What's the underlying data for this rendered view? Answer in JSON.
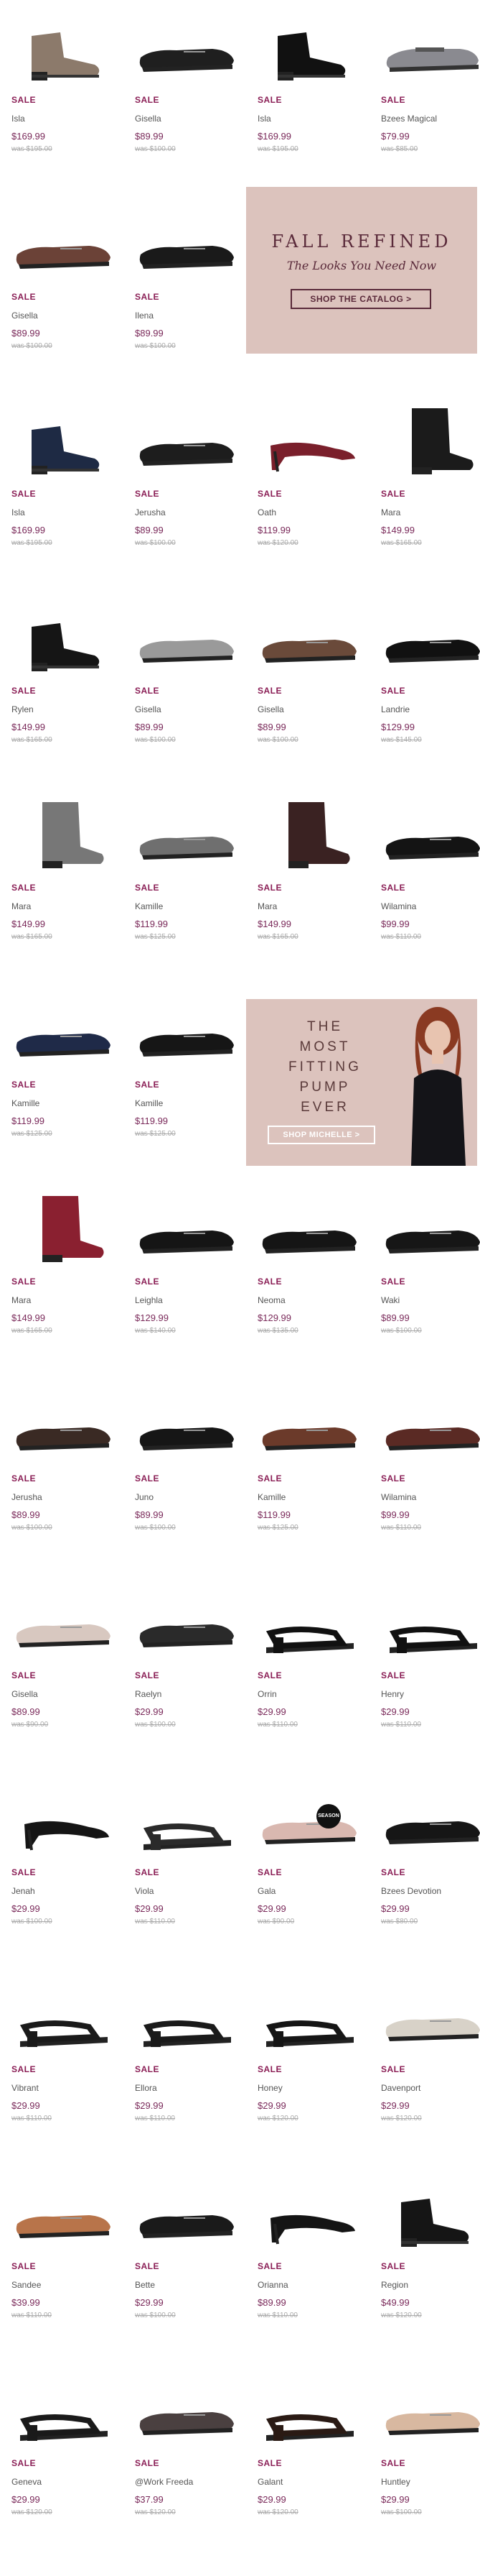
{
  "products": [
    {
      "sale": "SALE",
      "name": "Isla",
      "price": "$169.99",
      "was": "was $195.00",
      "color": "#8c7a6b",
      "shape": "bootie"
    },
    {
      "sale": "SALE",
      "name": "Gisella",
      "price": "$89.99",
      "was": "was $100.00",
      "color": "#1f1f1f",
      "shape": "loafer"
    },
    {
      "sale": "SALE",
      "name": "Isla",
      "price": "$169.99",
      "was": "was $195.00",
      "color": "#111111",
      "shape": "bootie"
    },
    {
      "sale": "SALE",
      "name": "Bzees Magical",
      "price": "$79.99",
      "was": "was $85.00",
      "color": "#8a8a90",
      "shape": "maryjane"
    },
    {
      "sale": "SALE",
      "name": "Gisella",
      "price": "$89.99",
      "was": "was $100.00",
      "color": "#6b4237",
      "shape": "loafer"
    },
    {
      "sale": "SALE",
      "name": "Ilena",
      "price": "$89.99",
      "was": "was $100.00",
      "color": "#1a1a1a",
      "shape": "loafer"
    },
    {
      "sale": "SALE",
      "name": "Isla",
      "price": "$169.99",
      "was": "was $195.00",
      "color": "#1e2a44",
      "shape": "bootie"
    },
    {
      "sale": "SALE",
      "name": "Jerusha",
      "price": "$89.99",
      "was": "was $100.00",
      "color": "#1d1d1d",
      "shape": "loafer"
    },
    {
      "sale": "SALE",
      "name": "Oath",
      "price": "$119.99",
      "was": "was $120.00",
      "color": "#7a1f2b",
      "shape": "pump"
    },
    {
      "sale": "SALE",
      "name": "Mara",
      "price": "$149.99",
      "was": "was $165.00",
      "color": "#1b1b1b",
      "shape": "boot"
    },
    {
      "sale": "SALE",
      "name": "Rylen",
      "price": "$149.99",
      "was": "was $165.00",
      "color": "#151515",
      "shape": "bootie"
    },
    {
      "sale": "SALE",
      "name": "Gisella",
      "price": "$89.99",
      "was": "was $100.00",
      "color": "#9a9a9a",
      "shape": "loafer"
    },
    {
      "sale": "SALE",
      "name": "Gisella",
      "price": "$89.99",
      "was": "was $100.00",
      "color": "#6a4a3a",
      "shape": "loafer"
    },
    {
      "sale": "SALE",
      "name": "Landrie",
      "price": "$129.99",
      "was": "was $145.00",
      "color": "#111111",
      "shape": "loafer"
    },
    {
      "sale": "SALE",
      "name": "Mara",
      "price": "$149.99",
      "was": "was $165.00",
      "color": "#777777",
      "shape": "boot"
    },
    {
      "sale": "SALE",
      "name": "Kamille",
      "price": "$119.99",
      "was": "was $125.00",
      "color": "#6f6f6f",
      "shape": "loafer"
    },
    {
      "sale": "SALE",
      "name": "Mara",
      "price": "$149.99",
      "was": "was $165.00",
      "color": "#3a2222",
      "shape": "boot"
    },
    {
      "sale": "SALE",
      "name": "Wilamina",
      "price": "$99.99",
      "was": "was $110.00",
      "color": "#141414",
      "shape": "loafer"
    },
    {
      "sale": "SALE",
      "name": "Kamille",
      "price": "$119.99",
      "was": "was $125.00",
      "color": "#1f2a48",
      "shape": "loafer"
    },
    {
      "sale": "SALE",
      "name": "Kamille",
      "price": "$119.99",
      "was": "was $125.00",
      "color": "#161616",
      "shape": "loafer"
    },
    {
      "sale": "SALE",
      "name": "Mara",
      "price": "$149.99",
      "was": "was $165.00",
      "color": "#8a2030",
      "shape": "boot"
    },
    {
      "sale": "SALE",
      "name": "Leighla",
      "price": "$129.99",
      "was": "was $140.00",
      "color": "#151515",
      "shape": "loafer"
    },
    {
      "sale": "SALE",
      "name": "Neoma",
      "price": "$129.99",
      "was": "was $135.00",
      "color": "#151515",
      "shape": "loafer"
    },
    {
      "sale": "SALE",
      "name": "Waki",
      "price": "$89.99",
      "was": "was $100.00",
      "color": "#161616",
      "shape": "loafer"
    },
    {
      "sale": "SALE",
      "name": "Jerusha",
      "price": "$89.99",
      "was": "was $100.00",
      "color": "#3a2a24",
      "shape": "loafer"
    },
    {
      "sale": "SALE",
      "name": "Juno",
      "price": "$89.99",
      "was": "was $100.00",
      "color": "#161616",
      "shape": "loafer"
    },
    {
      "sale": "SALE",
      "name": "Kamille",
      "price": "$119.99",
      "was": "was $125.00",
      "color": "#6b3a2a",
      "shape": "loafer"
    },
    {
      "sale": "SALE",
      "name": "Wilamina",
      "price": "$99.99",
      "was": "was $110.00",
      "color": "#5a2a24",
      "shape": "loafer"
    },
    {
      "sale": "SALE",
      "name": "Gisella",
      "price": "$89.99",
      "was": "was $90.00",
      "color": "#d8c8c0",
      "shape": "loafer"
    },
    {
      "sale": "SALE",
      "name": "Raelyn",
      "price": "$29.99",
      "was": "was $100.00",
      "color": "#2a2a2a",
      "shape": "loafer"
    },
    {
      "sale": "SALE",
      "name": "Orrin",
      "price": "$29.99",
      "was": "was $110.00",
      "color": "#111111",
      "shape": "sandal"
    },
    {
      "sale": "SALE",
      "name": "Henry",
      "price": "$29.99",
      "was": "was $110.00",
      "color": "#111111",
      "shape": "sandal"
    },
    {
      "sale": "SALE",
      "name": "Jenah",
      "price": "$29.99",
      "was": "was $100.00",
      "color": "#151515",
      "shape": "pump"
    },
    {
      "sale": "SALE",
      "name": "Viola",
      "price": "$29.99",
      "was": "was $110.00",
      "color": "#2a2a2a",
      "shape": "sandal"
    },
    {
      "sale": "SALE",
      "name": "Gala",
      "price": "$29.99",
      "was": "was $90.00",
      "color": "#d9b8b0",
      "shape": "loafer"
    },
    {
      "sale": "SALE",
      "name": "Bzees Devotion",
      "price": "$29.99",
      "was": "was $80.00",
      "color": "#161616",
      "shape": "loafer"
    },
    {
      "sale": "SALE",
      "name": "Vibrant",
      "price": "$29.99",
      "was": "was $110.00",
      "color": "#1a1a1a",
      "shape": "sandal"
    },
    {
      "sale": "SALE",
      "name": "Ellora",
      "price": "$29.99",
      "was": "was $110.00",
      "color": "#1a1a1a",
      "shape": "sandal"
    },
    {
      "sale": "SALE",
      "name": "Honey",
      "price": "$29.99",
      "was": "was $120.00",
      "color": "#151515",
      "shape": "sandal"
    },
    {
      "sale": "SALE",
      "name": "Davenport",
      "price": "$29.99",
      "was": "was $120.00",
      "color": "#d8d2c8",
      "shape": "loafer"
    },
    {
      "sale": "SALE",
      "name": "Sandee",
      "price": "$39.99",
      "was": "was $110.00",
      "color": "#b8744a",
      "shape": "loafer"
    },
    {
      "sale": "SALE",
      "name": "Bette",
      "price": "$29.99",
      "was": "was $100.00",
      "color": "#1a1a1a",
      "shape": "loafer"
    },
    {
      "sale": "SALE",
      "name": "Orianna",
      "price": "$89.99",
      "was": "was $110.00",
      "color": "#141414",
      "shape": "pump"
    },
    {
      "sale": "SALE",
      "name": "Region",
      "price": "$49.99",
      "was": "was $120.00",
      "color": "#151515",
      "shape": "bootie"
    },
    {
      "sale": "SALE",
      "name": "Geneva",
      "price": "$29.99",
      "was": "was $120.00",
      "color": "#1a1a1a",
      "shape": "sandal"
    },
    {
      "sale": "SALE",
      "name": "@Work Freeda",
      "price": "$37.99",
      "was": "was $120.00",
      "color": "#4a4040",
      "shape": "loafer"
    },
    {
      "sale": "SALE",
      "name": "Galant",
      "price": "$29.99",
      "was": "was $120.00",
      "color": "#2a1a14",
      "shape": "sandal"
    },
    {
      "sale": "SALE",
      "name": "Huntley",
      "price": "$29.99",
      "was": "was $100.00",
      "color": "#d8b8a0",
      "shape": "loafer"
    }
  ],
  "banner_fall": {
    "line1": "FALL REFINED",
    "line2": "The Looks You Need Now",
    "button": "SHOP THE CATALOG >"
  },
  "banner_pump": {
    "lines": [
      "THE",
      "MOST",
      "FITTING",
      "PUMP",
      "EVER"
    ],
    "button": "SHOP MICHELLE >"
  },
  "season_badge": "SEASON",
  "colors": {
    "sale": "#8a1e55",
    "banner_bg": "#dcc3bd",
    "banner_text": "#5a2a3a"
  }
}
